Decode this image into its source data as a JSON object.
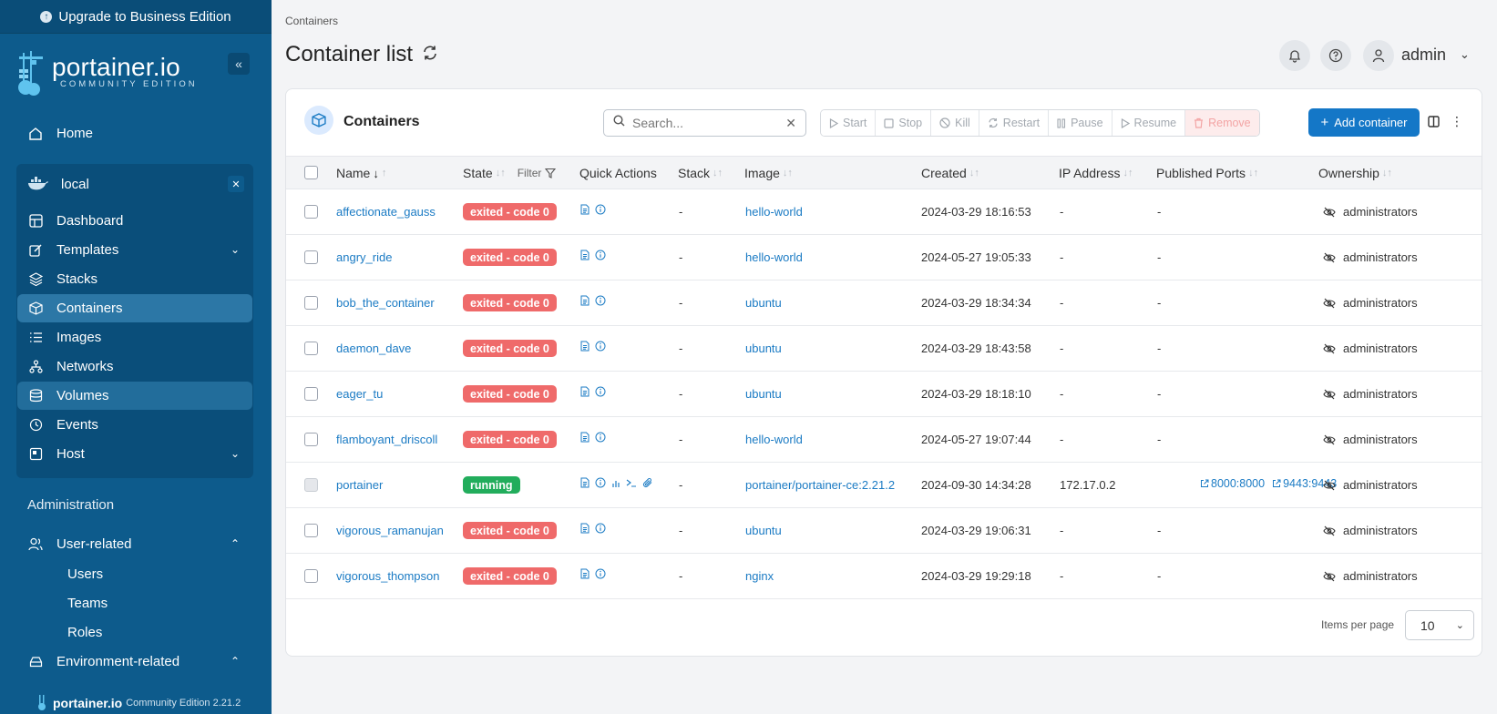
{
  "upgrade_label": "Upgrade to Business Edition",
  "brand": {
    "name": "portainer.io",
    "edition": "COMMUNITY EDITION"
  },
  "nav": {
    "home": "Home",
    "environment": "local",
    "items": {
      "dashboard": "Dashboard",
      "templates": "Templates",
      "stacks": "Stacks",
      "containers": "Containers",
      "images": "Images",
      "networks": "Networks",
      "volumes": "Volumes",
      "events": "Events",
      "host": "Host"
    },
    "administration": "Administration",
    "user_related": "User-related",
    "users": "Users",
    "teams": "Teams",
    "roles": "Roles",
    "environment_related": "Environment-related"
  },
  "footer": {
    "name": "portainer.io",
    "version": "Community Edition 2.21.2"
  },
  "breadcrumb": "Containers",
  "page_title": "Container list",
  "user": "admin",
  "card": {
    "title": "Containers",
    "search_placeholder": "Search...",
    "actions": {
      "start": "Start",
      "stop": "Stop",
      "kill": "Kill",
      "restart": "Restart",
      "pause": "Pause",
      "resume": "Resume",
      "remove": "Remove"
    },
    "add_label": "Add container"
  },
  "columns": {
    "name": "Name",
    "state": "State",
    "filter": "Filter",
    "quick_actions": "Quick Actions",
    "stack": "Stack",
    "image": "Image",
    "created": "Created",
    "ip": "IP Address",
    "ports": "Published Ports",
    "ownership": "Ownership"
  },
  "rows": [
    {
      "name": "affectionate_gauss",
      "state": "exited - code 0",
      "stack": "-",
      "image": "hello-world",
      "created": "2024-03-29 18:16:53",
      "ip": "-",
      "ports": "-",
      "owner": "administrators"
    },
    {
      "name": "angry_ride",
      "state": "exited - code 0",
      "stack": "-",
      "image": "hello-world",
      "created": "2024-05-27 19:05:33",
      "ip": "-",
      "ports": "-",
      "owner": "administrators"
    },
    {
      "name": "bob_the_container",
      "state": "exited - code 0",
      "stack": "-",
      "image": "ubuntu",
      "created": "2024-03-29 18:34:34",
      "ip": "-",
      "ports": "-",
      "owner": "administrators"
    },
    {
      "name": "daemon_dave",
      "state": "exited - code 0",
      "stack": "-",
      "image": "ubuntu",
      "created": "2024-03-29 18:43:58",
      "ip": "-",
      "ports": "-",
      "owner": "administrators"
    },
    {
      "name": "eager_tu",
      "state": "exited - code 0",
      "stack": "-",
      "image": "ubuntu",
      "created": "2024-03-29 18:18:10",
      "ip": "-",
      "ports": "-",
      "owner": "administrators"
    },
    {
      "name": "flamboyant_driscoll",
      "state": "exited - code 0",
      "stack": "-",
      "image": "hello-world",
      "created": "2024-05-27 19:07:44",
      "ip": "-",
      "ports": "-",
      "owner": "administrators"
    },
    {
      "name": "portainer",
      "state": "running",
      "stack": "-",
      "image": "portainer/portainer-ce:2.21.2",
      "created": "2024-09-30 14:34:28",
      "ip": "172.17.0.2",
      "port1": "8000:8000",
      "port2": "9443:9443",
      "owner": "administrators"
    },
    {
      "name": "vigorous_ramanujan",
      "state": "exited - code 0",
      "stack": "-",
      "image": "ubuntu",
      "created": "2024-03-29 19:06:31",
      "ip": "-",
      "ports": "-",
      "owner": "administrators"
    },
    {
      "name": "vigorous_thompson",
      "state": "exited - code 0",
      "stack": "-",
      "image": "nginx",
      "created": "2024-03-29 19:29:18",
      "ip": "-",
      "ports": "-",
      "owner": "administrators"
    }
  ],
  "items_per_page_label": "Items per page",
  "items_per_page": "10",
  "colors": {
    "sidebar": "#0d5b8c",
    "accent": "#1477c7",
    "exited": "#ef6a6a",
    "running": "#22ad5c",
    "link": "#1b7bc4"
  }
}
